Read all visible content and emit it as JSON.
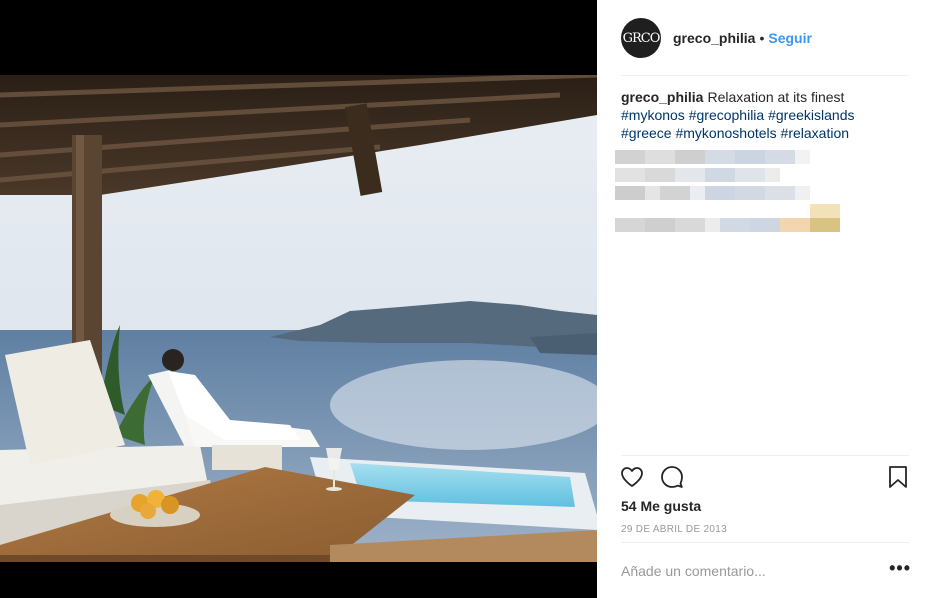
{
  "post": {
    "username": "greco_philia",
    "avatar_text": "GRCO",
    "separator": "•",
    "follow_label": "Seguir",
    "caption": {
      "user": "greco_philia",
      "text": "Relaxation at its finest",
      "hashtags": [
        "#mykonos",
        "#grecophilia",
        "#greekislands",
        "#greece",
        "#mykonoshotels",
        "#relaxation"
      ]
    },
    "likes": "54 Me gusta",
    "date": "29 DE ABRIL DE 2013",
    "comment_placeholder": "Añade un comentario...",
    "more_label": "•••"
  },
  "icons": {
    "like": "heart-icon",
    "comment": "comment-bubble-icon",
    "save": "bookmark-icon"
  },
  "colors": {
    "link_blue": "#3897f0",
    "hashtag": "#003569",
    "text": "#262626",
    "muted": "#999999",
    "divider": "#efefef"
  }
}
